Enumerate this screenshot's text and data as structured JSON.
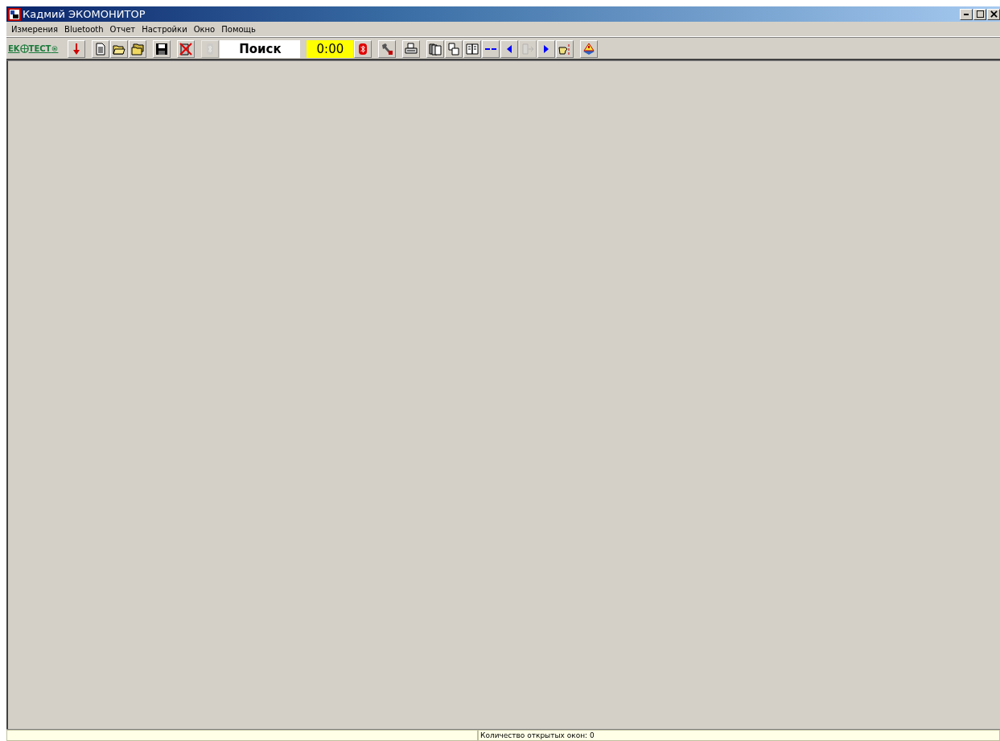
{
  "window": {
    "title": "Кадмий ЭКОМОНИТОР"
  },
  "menu": [
    "Измерения",
    "Bluetooth",
    "Отчет",
    "Настройки",
    "Окно",
    "Помощь"
  ],
  "logo": {
    "left": "EK",
    "right": "TECT",
    "mark": "®"
  },
  "toolbar": [
    [
      {
        "kind": "button",
        "disabled": false
      }
    ],
    [
      {
        "kind": "button",
        "disabled": false
      },
      {
        "kind": "button",
        "disabled": false
      },
      {
        "kind": "button",
        "disabled": false
      }
    ],
    [
      {
        "kind": "button",
        "disabled": false
      }
    ],
    [
      {
        "kind": "button",
        "disabled": false
      }
    ],
    [
      {
        "kind": "button",
        "disabled": true
      },
      {
        "kind": "search_label",
        "text": "Поиск"
      }
    ],
    [
      {
        "kind": "timer",
        "text": "0:00"
      },
      {
        "kind": "button",
        "disabled": false
      }
    ],
    [
      {
        "kind": "button",
        "disabled": false
      }
    ],
    [
      {
        "kind": "button",
        "disabled": false
      }
    ],
    [
      {
        "kind": "button",
        "disabled": false
      },
      {
        "kind": "button",
        "disabled": false
      },
      {
        "kind": "button",
        "disabled": false
      },
      {
        "kind": "button",
        "disabled": false
      },
      {
        "kind": "button",
        "disabled": false
      },
      {
        "kind": "button",
        "disabled": true
      },
      {
        "kind": "button",
        "disabled": false
      },
      {
        "kind": "button",
        "disabled": false
      }
    ],
    [
      {
        "kind": "button",
        "disabled": false
      }
    ]
  ],
  "status_bar": {
    "panel_2": "Количество открытых окон: 0"
  }
}
